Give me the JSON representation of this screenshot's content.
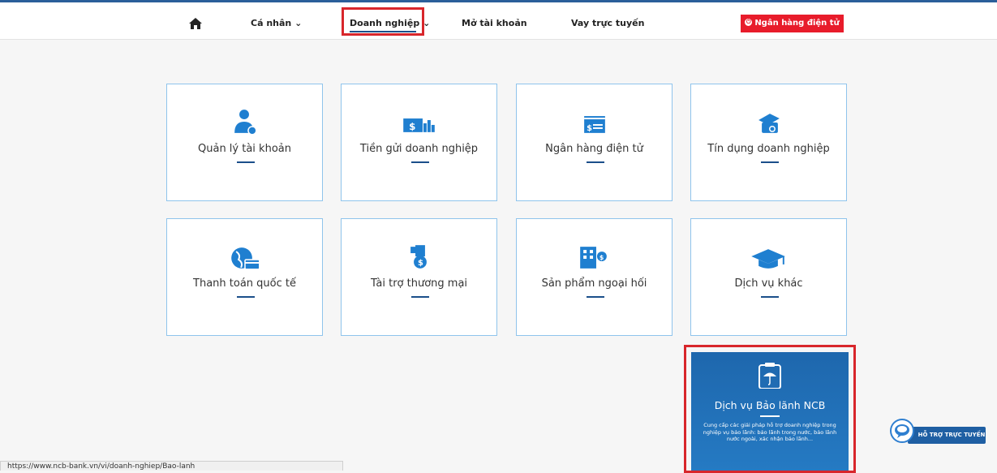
{
  "nav": {
    "items": [
      "Cá nhân ⌄",
      "Doanh nghiệp ⌄",
      "Mở tài khoản",
      "Vay trực tuyến"
    ],
    "ebank_label": "Ngân hàng điện tử",
    "home_icon": "home-icon"
  },
  "cards": [
    {
      "label": "Quản lý tài khoản",
      "icon": "account-manager-icon"
    },
    {
      "label": "Tiền gửi doanh nghiệp",
      "icon": "deposit-money-icon"
    },
    {
      "label": "Ngân hàng điện tử",
      "icon": "ebanking-card-icon"
    },
    {
      "label": "Tín dụng doanh nghiệp",
      "icon": "credit-hand-icon"
    },
    {
      "label": "Thanh toán quốc tế",
      "icon": "globe-card-icon"
    },
    {
      "label": "Tài trợ thương mại",
      "icon": "trade-finance-icon"
    },
    {
      "label": "Sản phẩm ngoại hối",
      "icon": "forex-building-icon"
    },
    {
      "label": "Dịch vụ khác",
      "icon": "graduation-cap-icon"
    }
  ],
  "featured": {
    "title": "Dịch vụ Bảo lãnh NCB",
    "description": "Cung cấp các giải pháp hỗ trợ doanh nghiệp trong nghiệp vụ bảo lãnh: bảo lãnh trong nước, bảo lãnh nước ngoài, xác nhận bảo lãnh...",
    "icon": "clipboard-umbrella-icon"
  },
  "status_url": "https://www.ncb-bank.vn/vi/doanh-nghiep/Bao-lanh",
  "support_label": "HỖ TRỢ TRỰC TUYẾN",
  "colors": {
    "accent": "#1b4f8a",
    "brand_red": "#e81c2b",
    "icon_blue": "#1f7fd0",
    "card_border": "#8fc4ec"
  }
}
